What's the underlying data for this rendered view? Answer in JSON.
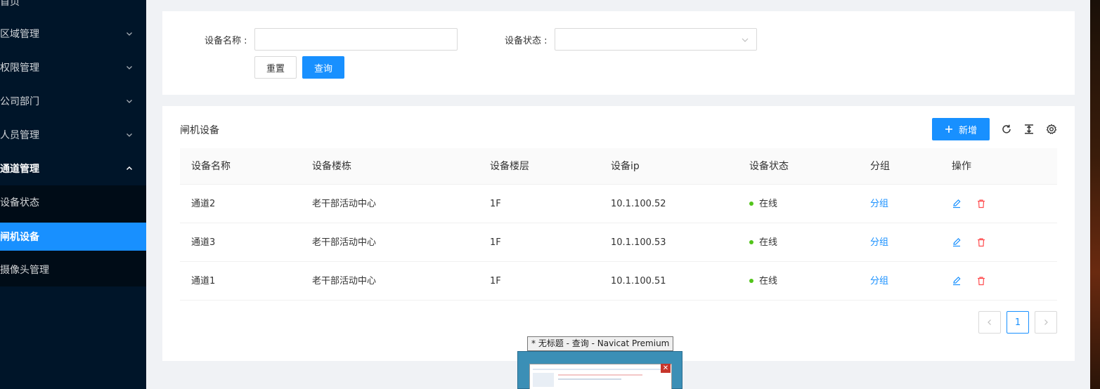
{
  "sidebar": {
    "top_item": "首页",
    "menus": [
      {
        "label": "区域管理"
      },
      {
        "label": "权限管理"
      },
      {
        "label": "公司部门"
      },
      {
        "label": "人员管理"
      },
      {
        "label": "通道管理"
      }
    ],
    "submenu": [
      {
        "label": "设备状态"
      },
      {
        "label": "闸机设备"
      },
      {
        "label": "摄像头管理"
      }
    ]
  },
  "search": {
    "name_label": "设备名称 :",
    "name_value": "",
    "status_label": "设备状态 :",
    "status_value": "",
    "reset_label": "重置",
    "query_label": "查询"
  },
  "table": {
    "title": "闸机设备",
    "add_label": "新增",
    "columns": [
      "设备名称",
      "设备楼栋",
      "设备楼层",
      "设备ip",
      "设备状态",
      "分组",
      "操作"
    ],
    "rows": [
      {
        "name": "通道2",
        "building": "老干部活动中心",
        "floor": "1F",
        "ip": "10.1.100.52",
        "status": "在线",
        "group": "分组"
      },
      {
        "name": "通道3",
        "building": "老干部活动中心",
        "floor": "1F",
        "ip": "10.1.100.53",
        "status": "在线",
        "group": "分组"
      },
      {
        "name": "通道1",
        "building": "老干部活动中心",
        "floor": "1F",
        "ip": "10.1.100.51",
        "status": "在线",
        "group": "分组"
      }
    ],
    "page": "1"
  },
  "taskbar_thumb": {
    "title": "* 无标题 - 查询 - Navicat Premium"
  },
  "colors": {
    "sidebar_bg": "#001529",
    "primary": "#1890ff",
    "online": "#52c41a",
    "danger": "#ff4d4f"
  }
}
